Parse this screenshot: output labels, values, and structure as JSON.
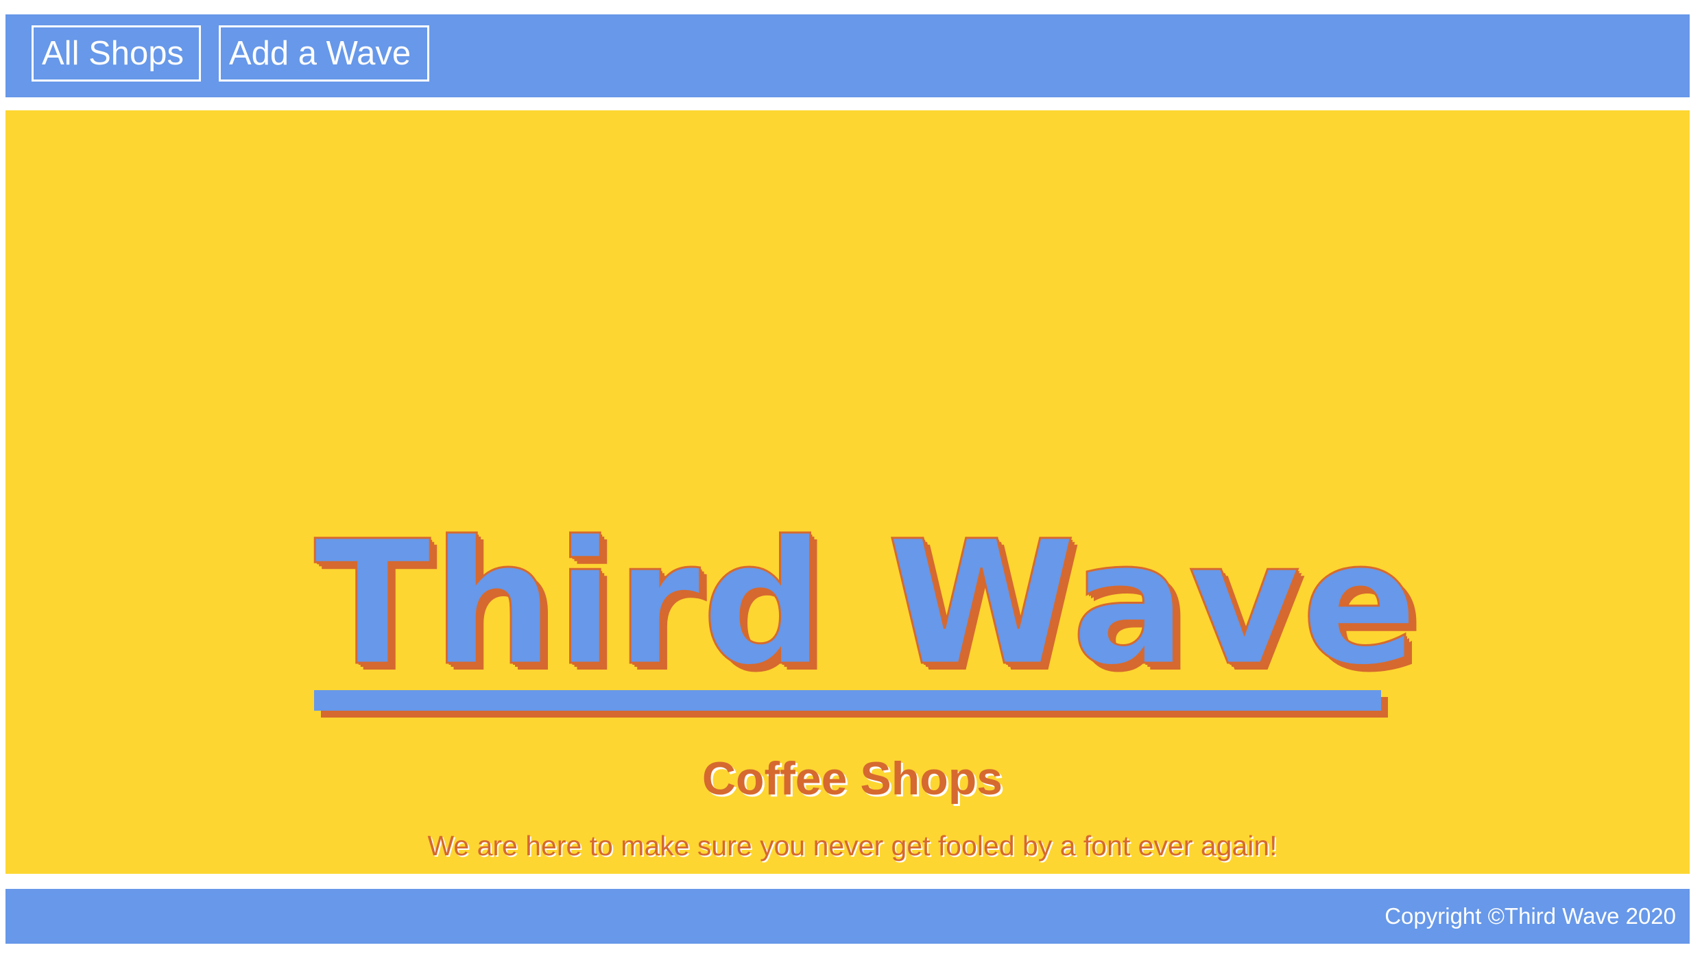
{
  "nav": {
    "all_shops": "All Shops",
    "add_wave": "Add a Wave"
  },
  "hero": {
    "title": "Third Wave",
    "subtitle": "Coffee Shops",
    "tagline": "We are here to make sure you never get fooled by a font ever again!"
  },
  "footer": {
    "copyright": "Copyright ©Third Wave 2020"
  },
  "colors": {
    "nav_blue": "#6798e9",
    "hero_yellow": "#fdd631",
    "accent_orange": "#d6692f",
    "text_white": "#ffffff"
  }
}
